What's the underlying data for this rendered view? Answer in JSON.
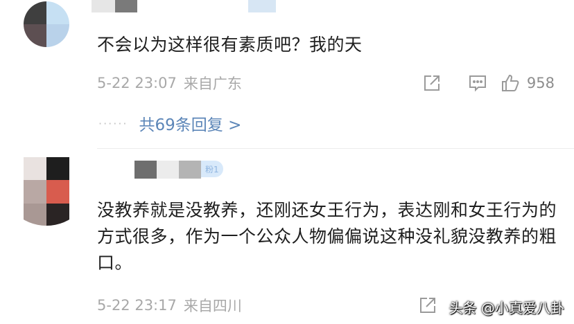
{
  "comments": [
    {
      "text": "不会以为这样很有素质吧？我的天",
      "meta": {
        "time": "5-22 23:07",
        "location": "来自广东"
      },
      "likes": "958",
      "replies_label": "共69条回复 >",
      "avatar_colors": [
        "#3f3f3f",
        "#c6e0f3",
        "#5d4f52",
        "#b9d2ea"
      ],
      "name_blur_colors": [
        "#d0d0d0",
        "#7a7a7a",
        "#ffffff",
        "#d7e6f4"
      ]
    },
    {
      "badge": "粉1",
      "text": "没教养就是没教养，还刚还女王行为，表达刚和女王行为的方式很多，作为一个公众人物偏偏说这种没礼貌没教养的粗口。",
      "meta": {
        "time": "5-22 23:17",
        "location": "来自四川"
      },
      "avatar_colors": [
        "#e9e2e0",
        "#1e1e1e",
        "#b9a8a4",
        "#d85c4e",
        "#a99894",
        "#2a2424"
      ],
      "name_blur_colors": [
        "#6e6e6e",
        "#ececec",
        "#b4b4b4"
      ]
    }
  ],
  "watermark": {
    "text": "头条 @小真爱八卦"
  }
}
